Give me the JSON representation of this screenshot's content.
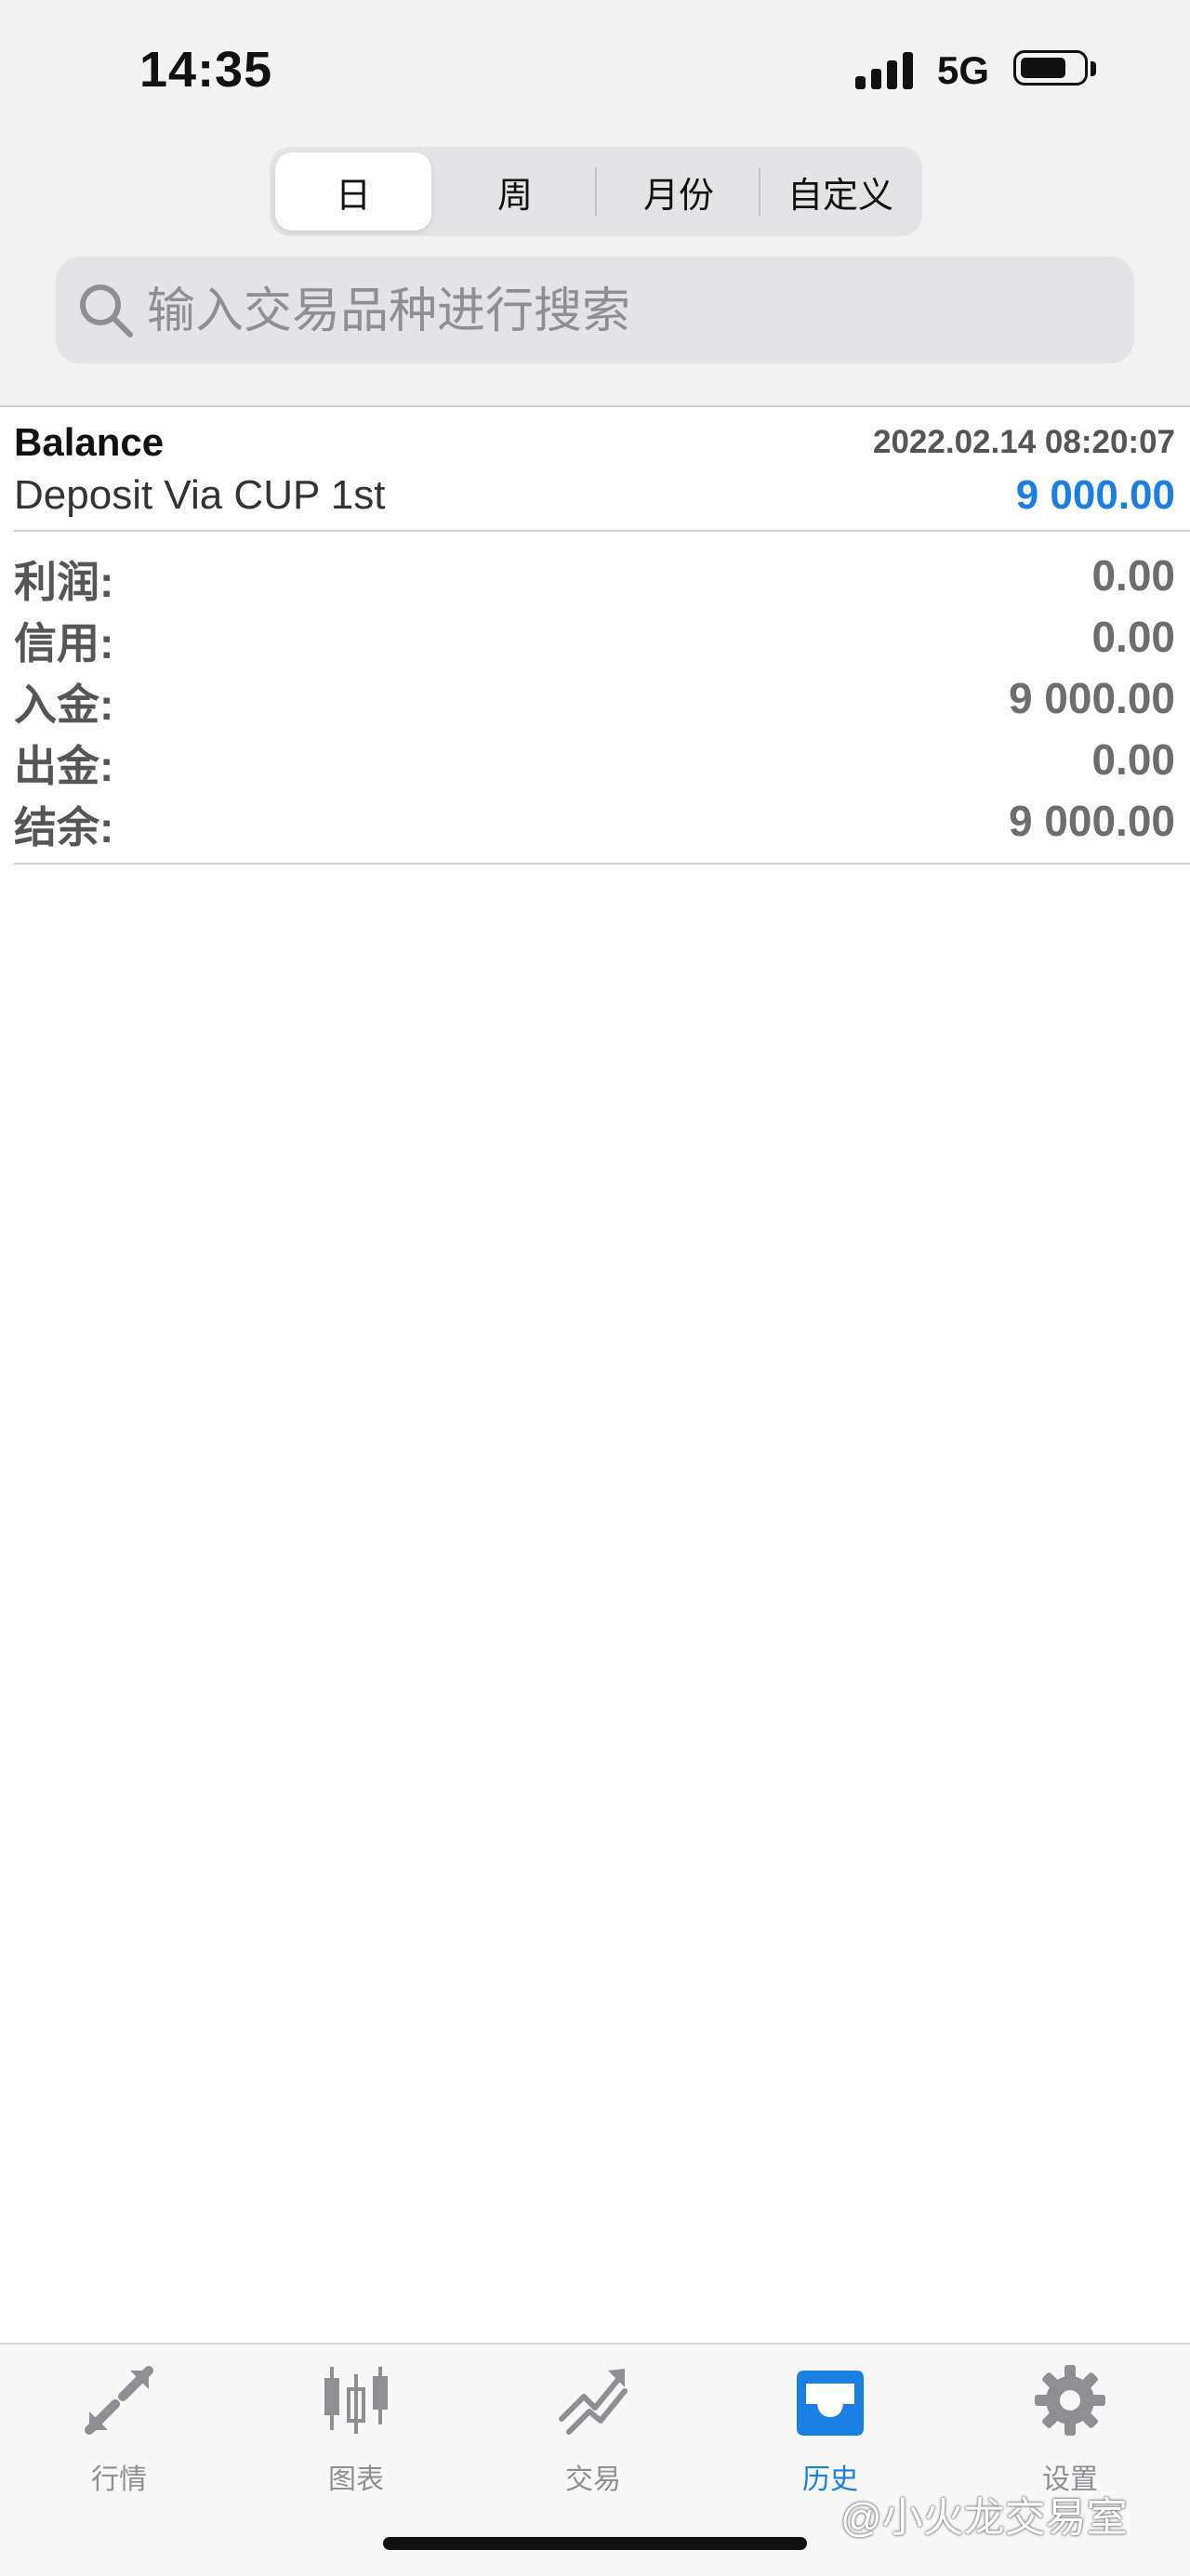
{
  "status_bar": {
    "time": "14:35",
    "network": "5G"
  },
  "period_tabs": [
    {
      "label": "日",
      "active": true
    },
    {
      "label": "周",
      "active": false
    },
    {
      "label": "月份",
      "active": false
    },
    {
      "label": "自定义",
      "active": false
    }
  ],
  "search": {
    "placeholder": "输入交易品种进行搜索",
    "value": ""
  },
  "deal": {
    "type": "Balance",
    "time": "2022.02.14 08:20:07",
    "comment": "Deposit Via CUP 1st",
    "amount": "9 000.00",
    "amount_color": "#1a7fe3"
  },
  "summary": [
    {
      "label": "利润:",
      "value": "0.00"
    },
    {
      "label": "信用:",
      "value": "0.00"
    },
    {
      "label": "入金:",
      "value": "9 000.00"
    },
    {
      "label": "出金:",
      "value": "0.00"
    },
    {
      "label": "结余:",
      "value": "9 000.00"
    }
  ],
  "tab_bar": [
    {
      "label": "行情",
      "icon": "quotes-arrows-icon",
      "active": false
    },
    {
      "label": "图表",
      "icon": "candlestick-chart-icon",
      "active": false
    },
    {
      "label": "交易",
      "icon": "trade-trend-icon",
      "active": false
    },
    {
      "label": "历史",
      "icon": "history-inbox-icon",
      "active": true
    },
    {
      "label": "设置",
      "icon": "gear-icon",
      "active": false
    }
  ],
  "watermark": "@小火龙交易室",
  "colors": {
    "accent": "#1a7fe3",
    "inactive_tab": "#8e8e93"
  }
}
